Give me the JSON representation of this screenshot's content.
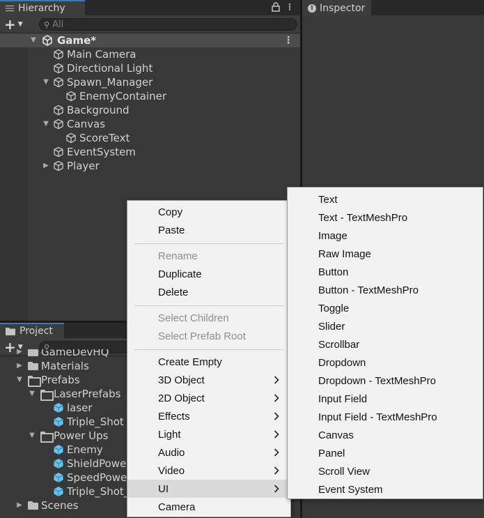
{
  "hierarchy": {
    "tab_label": "Hierarchy",
    "search_placeholder": "All",
    "scene_name": "Game*",
    "items": [
      {
        "label": "Main Camera",
        "depth": 0,
        "expander": "none"
      },
      {
        "label": "Directional Light",
        "depth": 0,
        "expander": "none"
      },
      {
        "label": "Spawn_Manager",
        "depth": 0,
        "expander": "expanded"
      },
      {
        "label": "EnemyContainer",
        "depth": 1,
        "expander": "none"
      },
      {
        "label": "Background",
        "depth": 0,
        "expander": "none"
      },
      {
        "label": "Canvas",
        "depth": 0,
        "expander": "expanded"
      },
      {
        "label": "ScoreText",
        "depth": 1,
        "expander": "none"
      },
      {
        "label": "EventSystem",
        "depth": 0,
        "expander": "none"
      },
      {
        "label": "Player",
        "depth": 0,
        "expander": "collapsed"
      }
    ]
  },
  "project": {
    "tab_label": "Project",
    "items": [
      {
        "label": "GameDevHQ",
        "type": "folder",
        "depth": 0,
        "expander": "collapsed"
      },
      {
        "label": "Materials",
        "type": "folder",
        "depth": 0,
        "expander": "collapsed"
      },
      {
        "label": "Prefabs",
        "type": "folder-open",
        "depth": 0,
        "expander": "expanded"
      },
      {
        "label": "LaserPrefabs",
        "type": "folder-open",
        "depth": 1,
        "expander": "expanded"
      },
      {
        "label": "laser",
        "type": "prefab",
        "depth": 2,
        "expander": "none"
      },
      {
        "label": "Triple_Shot",
        "type": "prefab",
        "depth": 2,
        "expander": "none"
      },
      {
        "label": "Power Ups",
        "type": "folder-open",
        "depth": 1,
        "expander": "expanded"
      },
      {
        "label": "Enemy",
        "type": "prefab",
        "depth": 2,
        "expander": "none"
      },
      {
        "label": "ShieldPowe",
        "type": "prefab",
        "depth": 2,
        "expander": "none"
      },
      {
        "label": "SpeedPowe",
        "type": "prefab",
        "depth": 2,
        "expander": "none"
      },
      {
        "label": "Triple_Shot_",
        "type": "prefab",
        "depth": 2,
        "expander": "none"
      },
      {
        "label": "Scenes",
        "type": "folder",
        "depth": 0,
        "expander": "collapsed"
      }
    ]
  },
  "inspector": {
    "tab_label": "Inspector"
  },
  "context_menu": {
    "groups": [
      [
        {
          "label": "Copy",
          "enabled": true
        },
        {
          "label": "Paste",
          "enabled": true
        }
      ],
      [
        {
          "label": "Rename",
          "enabled": false
        },
        {
          "label": "Duplicate",
          "enabled": true
        },
        {
          "label": "Delete",
          "enabled": true
        }
      ],
      [
        {
          "label": "Select Children",
          "enabled": false
        },
        {
          "label": "Select Prefab Root",
          "enabled": false
        }
      ],
      [
        {
          "label": "Create Empty",
          "enabled": true
        },
        {
          "label": "3D Object",
          "enabled": true,
          "submenu": true
        },
        {
          "label": "2D Object",
          "enabled": true,
          "submenu": true
        },
        {
          "label": "Effects",
          "enabled": true,
          "submenu": true
        },
        {
          "label": "Light",
          "enabled": true,
          "submenu": true
        },
        {
          "label": "Audio",
          "enabled": true,
          "submenu": true
        },
        {
          "label": "Video",
          "enabled": true,
          "submenu": true
        },
        {
          "label": "UI",
          "enabled": true,
          "submenu": true,
          "highlighted": true
        },
        {
          "label": "Camera",
          "enabled": true
        }
      ]
    ]
  },
  "ui_submenu": {
    "items": [
      "Text",
      "Text - TextMeshPro",
      "Image",
      "Raw Image",
      "Button",
      "Button - TextMeshPro",
      "Toggle",
      "Slider",
      "Scrollbar",
      "Dropdown",
      "Dropdown - TextMeshPro",
      "Input Field",
      "Input Field - TextMeshPro",
      "Canvas",
      "Panel",
      "Scroll View",
      "Event System"
    ]
  },
  "colors": {
    "panel_bg": "#383838",
    "scene_row_bg": "#4c4c4c",
    "tab_accent": "#3a79bb",
    "menu_bg": "#f2f2f2",
    "menu_hover": "#dadada",
    "prefab_blue": "#66c3f0"
  }
}
